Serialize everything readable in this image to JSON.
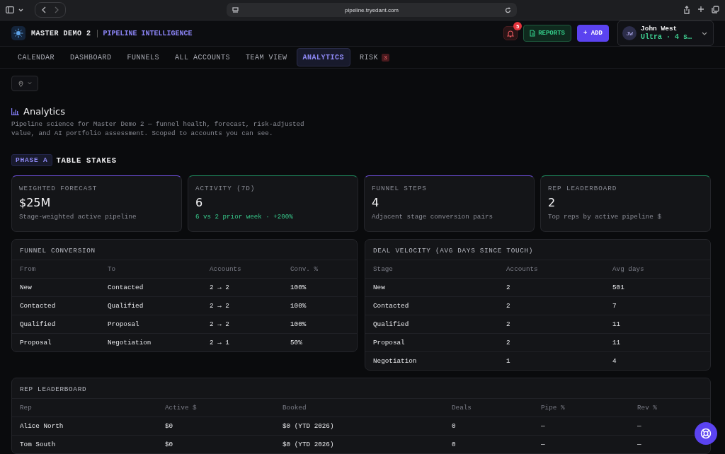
{
  "browser": {
    "url": "pipeline.tryedant.com"
  },
  "header": {
    "workspace": "MASTER DEMO 2",
    "product": "PIPELINE INTELLIGENCE",
    "notifications": "5",
    "reports": "REPORTS",
    "add": "+ ADD",
    "user": {
      "initials": "JW",
      "name": "John West",
      "plan": "Ultra · 4 s…"
    }
  },
  "tabs": [
    {
      "label": "CALENDAR",
      "selected": false
    },
    {
      "label": "DASHBOARD",
      "selected": false
    },
    {
      "label": "FUNNELS",
      "selected": false
    },
    {
      "label": "ALL ACCOUNTS",
      "selected": false
    },
    {
      "label": "TEAM VIEW",
      "selected": false
    },
    {
      "label": "ANALYTICS",
      "selected": true
    },
    {
      "label": "RISK",
      "selected": false,
      "badge": "3"
    }
  ],
  "page": {
    "title": "Analytics",
    "description": "Pipeline science for Master Demo 2 — funnel health, forecast, risk-adjusted value, and AI portfolio assessment. Scoped to accounts you can see.",
    "phase_badge": "PHASE A",
    "phase_title": "TABLE STAKES"
  },
  "stats": [
    {
      "label": "WEIGHTED FORECAST",
      "value": "$25M",
      "note": "Stage-weighted active pipeline",
      "color": "#6d4fd8",
      "positive": false
    },
    {
      "label": "ACTIVITY (7D)",
      "value": "6",
      "note": "6 vs 2 prior week · +200%",
      "color": "#1f8a5e",
      "positive": true
    },
    {
      "label": "FUNNEL STEPS",
      "value": "4",
      "note": "Adjacent stage conversion pairs",
      "color": "#6d4fd8",
      "positive": false
    },
    {
      "label": "REP LEADERBOARD",
      "value": "2",
      "note": "Top reps by active pipeline $",
      "color": "#1f8a5e",
      "positive": false
    }
  ],
  "tables": [
    {
      "title": "FUNNEL CONVERSION",
      "columns": [
        "From",
        "To",
        "Accounts",
        "Conv. %"
      ],
      "rows": [
        [
          "New",
          "Contacted",
          "2 → 2",
          "100%"
        ],
        [
          "Contacted",
          "Qualified",
          "2 → 2",
          "100%"
        ],
        [
          "Qualified",
          "Proposal",
          "2 → 2",
          "100%"
        ],
        [
          "Proposal",
          "Negotiation",
          "2 → 1",
          "50%"
        ]
      ]
    },
    {
      "title": "DEAL VELOCITY (AVG DAYS SINCE TOUCH)",
      "columns": [
        "Stage",
        "Accounts",
        "Avg days"
      ],
      "rows": [
        [
          "New",
          "2",
          "501"
        ],
        [
          "Contacted",
          "2",
          "7"
        ],
        [
          "Qualified",
          "2",
          "11"
        ],
        [
          "Proposal",
          "2",
          "11"
        ],
        [
          "Negotiation",
          "1",
          "4"
        ]
      ]
    },
    {
      "title": "REP LEADERBOARD",
      "columns": [
        "Rep",
        "Active $",
        "Booked",
        "Deals",
        "Pipe %",
        "Rev %"
      ],
      "rows": [
        [
          "Alice North",
          "$0",
          "$0 (YTD 2026)",
          "0",
          "—",
          "—"
        ],
        [
          "Tom South",
          "$0",
          "$0 (YTD 2026)",
          "0",
          "—",
          "—"
        ]
      ]
    }
  ]
}
